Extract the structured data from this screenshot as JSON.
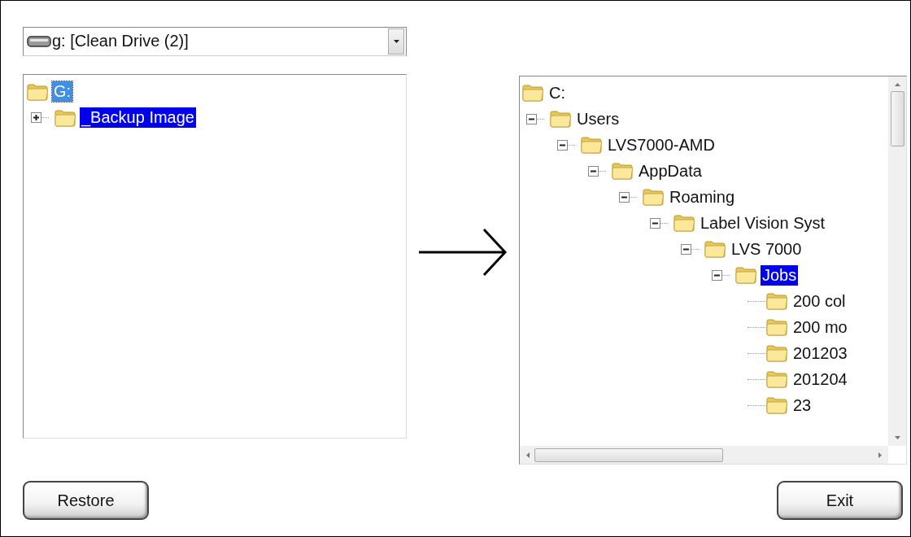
{
  "source": {
    "drive_select": {
      "value": "g: [Clean Drive (2)]"
    },
    "tree": [
      {
        "label": "G:",
        "selected": false,
        "focused": true,
        "children": [
          {
            "label": "_Backup Image",
            "expanded": false,
            "selected": true,
            "focused": false
          }
        ]
      }
    ]
  },
  "destination": {
    "tree": [
      {
        "label": "C:",
        "selected": false,
        "focused": false,
        "children": [
          {
            "label": "Users",
            "expanded": true,
            "selected": false,
            "focused": false,
            "children": [
              {
                "label": "LVS7000-AMD",
                "expanded": true,
                "selected": false,
                "focused": false,
                "children": [
                  {
                    "label": "AppData",
                    "expanded": true,
                    "selected": false,
                    "focused": false,
                    "children": [
                      {
                        "label": "Roaming",
                        "expanded": true,
                        "selected": false,
                        "focused": false,
                        "children": [
                          {
                            "label": "Label Vision Syst",
                            "expanded": true,
                            "selected": false,
                            "focused": false,
                            "children": [
                              {
                                "label": "LVS 7000",
                                "expanded": true,
                                "selected": false,
                                "focused": false,
                                "children": [
                                  {
                                    "label": "Jobs",
                                    "expanded": true,
                                    "selected": true,
                                    "focused": false,
                                    "children": [
                                      {
                                        "label": "200 col",
                                        "selected": false,
                                        "focused": false
                                      },
                                      {
                                        "label": "200 mo",
                                        "selected": false,
                                        "focused": false
                                      },
                                      {
                                        "label": "201203",
                                        "selected": false,
                                        "focused": false
                                      },
                                      {
                                        "label": "201204",
                                        "selected": false,
                                        "focused": false
                                      },
                                      {
                                        "label": "23",
                                        "selected": false,
                                        "focused": false
                                      }
                                    ]
                                  }
                                ]
                              }
                            ]
                          }
                        ]
                      }
                    ]
                  }
                ]
              }
            ]
          }
        ]
      }
    ]
  },
  "buttons": [
    {
      "label": "Restore"
    },
    {
      "label": "Exit"
    }
  ]
}
